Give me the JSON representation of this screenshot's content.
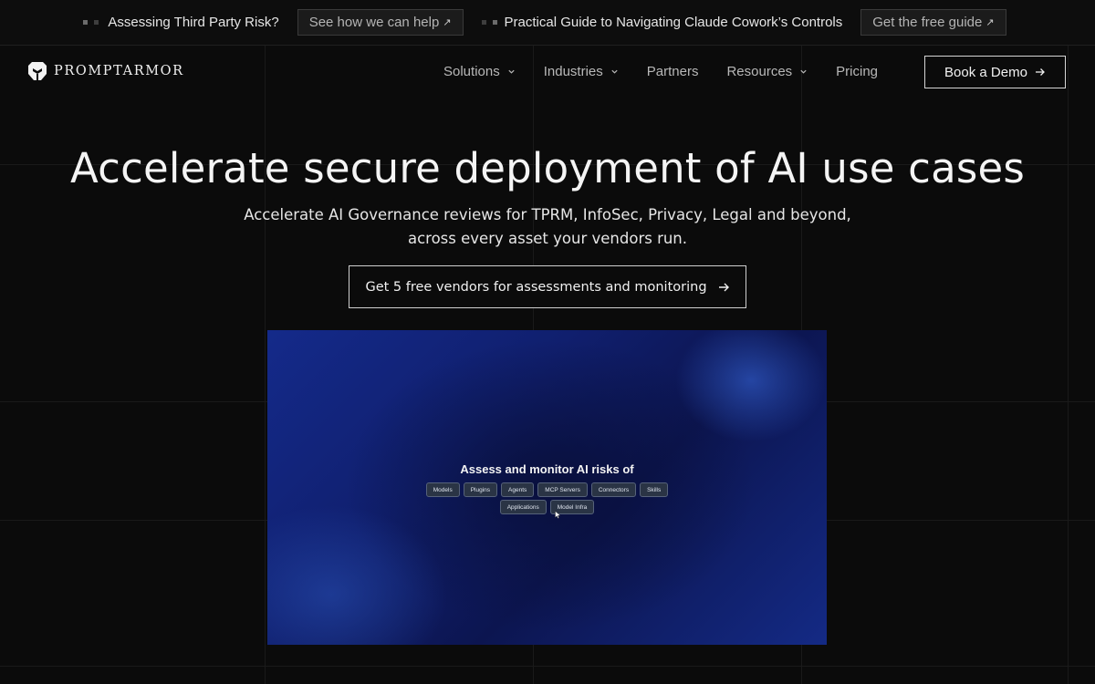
{
  "announcement": {
    "item1": {
      "text": "Assessing Third Party Risk?",
      "button": "See how we can help"
    },
    "item2": {
      "text": "Practical Guide to Navigating Claude Cowork’s Controls",
      "button": "Get the free guide"
    },
    "arrow_icon": "external-arrow-icon"
  },
  "nav": {
    "logo_text": "PROMPTARMOR",
    "items": [
      {
        "label": "Solutions",
        "has_dropdown": true
      },
      {
        "label": "Industries",
        "has_dropdown": true
      },
      {
        "label": "Partners",
        "has_dropdown": false
      },
      {
        "label": "Resources",
        "has_dropdown": true
      },
      {
        "label": "Pricing",
        "has_dropdown": false
      }
    ],
    "cta": "Book a Demo"
  },
  "hero": {
    "title": "Accelerate secure deployment of AI use cases",
    "subtitle_line1": "Accelerate AI Governance reviews for TPRM, InfoSec, Privacy, Legal and beyond,",
    "subtitle_line2": "across every asset your vendors run.",
    "cta": "Get 5 free vendors for assessments and monitoring"
  },
  "media": {
    "title": "Assess and monitor AI risks of",
    "chips_row1": [
      "Models",
      "Plugins",
      "Agents",
      "MCP Servers",
      "Connectors",
      "Skills"
    ],
    "chips_row2": [
      "Applications",
      "Model Infra"
    ]
  },
  "colors": {
    "background": "#0b0b0b",
    "text": "#f4f4f4",
    "muted": "#b8b8b8",
    "media_blue": "#142a8a"
  }
}
